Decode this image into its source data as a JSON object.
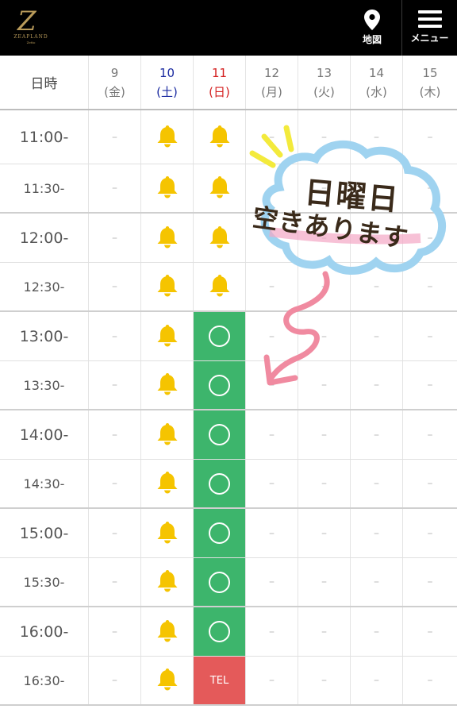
{
  "header": {
    "logo_letter": "Z",
    "logo_brand": "ZEAPLAND",
    "logo_sub": "Zetto",
    "map_label": "地図",
    "menu_label": "メニュー"
  },
  "table": {
    "corner_label": "日時",
    "days": [
      {
        "date": "9",
        "weekday": "(金)",
        "kind": "weekday"
      },
      {
        "date": "10",
        "weekday": "(土)",
        "kind": "sat"
      },
      {
        "date": "11",
        "weekday": "(日)",
        "kind": "sun"
      },
      {
        "date": "12",
        "weekday": "(月)",
        "kind": "weekday"
      },
      {
        "date": "13",
        "weekday": "(火)",
        "kind": "weekday"
      },
      {
        "date": "14",
        "weekday": "(水)",
        "kind": "weekday"
      },
      {
        "date": "15",
        "weekday": "(木)",
        "kind": "weekday"
      }
    ],
    "rows": [
      {
        "time": "11:00-",
        "slots": [
          "–",
          "bell",
          "bell",
          "–",
          "–",
          "–",
          "–"
        ]
      },
      {
        "time": "11:30-",
        "slots": [
          "–",
          "bell",
          "bell",
          "–",
          "–",
          "–",
          "–"
        ]
      },
      {
        "time": "12:00-",
        "slots": [
          "–",
          "bell",
          "bell",
          "–",
          "–",
          "–",
          "–"
        ]
      },
      {
        "time": "12:30-",
        "slots": [
          "–",
          "bell",
          "bell",
          "–",
          "–",
          "–",
          "–"
        ]
      },
      {
        "time": "13:00-",
        "slots": [
          "–",
          "bell",
          "open",
          "–",
          "–",
          "–",
          "–"
        ]
      },
      {
        "time": "13:30-",
        "slots": [
          "–",
          "bell",
          "open",
          "–",
          "–",
          "–",
          "–"
        ]
      },
      {
        "time": "14:00-",
        "slots": [
          "–",
          "bell",
          "open",
          "–",
          "–",
          "–",
          "–"
        ]
      },
      {
        "time": "14:30-",
        "slots": [
          "–",
          "bell",
          "open",
          "–",
          "–",
          "–",
          "–"
        ]
      },
      {
        "time": "15:00-",
        "slots": [
          "–",
          "bell",
          "open",
          "–",
          "–",
          "–",
          "–"
        ]
      },
      {
        "time": "15:30-",
        "slots": [
          "–",
          "bell",
          "open",
          "–",
          "–",
          "–",
          "–"
        ]
      },
      {
        "time": "16:00-",
        "slots": [
          "–",
          "bell",
          "open",
          "–",
          "–",
          "–",
          "–"
        ]
      },
      {
        "time": "16:30-",
        "slots": [
          "–",
          "bell",
          "TEL",
          "–",
          "–",
          "–",
          "–"
        ]
      }
    ]
  },
  "sticker": {
    "line1": "日曜日",
    "line2": "空きあります"
  },
  "colors": {
    "header_bg": "#000000",
    "saturday": "#1a2aa0",
    "sunday": "#d42020",
    "available": "#3db56c",
    "tel": "#e45a5a",
    "bell": "#f5c400",
    "cloud": "#9fd3f0",
    "arrow": "#f08aa0"
  },
  "icons": {
    "map": "map-pin-icon",
    "menu": "hamburger-menu-icon",
    "slot_request": "bell-icon",
    "slot_open": "circle-icon"
  }
}
